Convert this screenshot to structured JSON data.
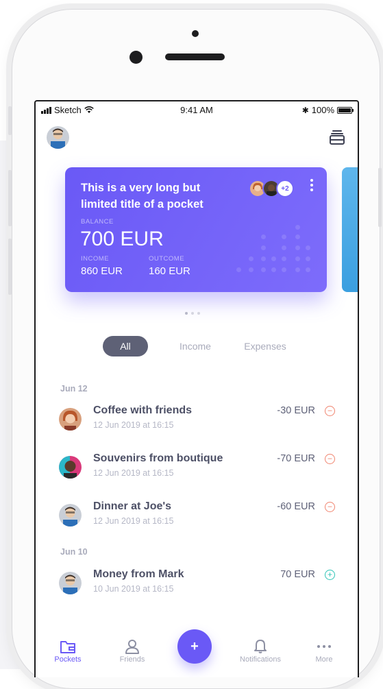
{
  "status_bar": {
    "carrier": "Sketch",
    "time": "9:41 AM",
    "battery": "100%"
  },
  "card": {
    "title": "This is a very long but limited title of a pocket",
    "members_extra": "+2",
    "balance_label": "BALANCE",
    "balance": "700 EUR",
    "income_label": "INCOME",
    "income": "860 EUR",
    "outcome_label": "OUTCOME",
    "outcome": "160 EUR"
  },
  "filter_tabs": [
    {
      "label": "All"
    },
    {
      "label": "Income"
    },
    {
      "label": "Expenses"
    }
  ],
  "groups": [
    {
      "date": "Jun 12"
    },
    {
      "date": "Jun 10"
    }
  ],
  "transactions": [
    {
      "title": "Coffee with friends",
      "subtitle": "12 Jun 2019 at 16:15",
      "amount": "-30 EUR",
      "sign": "−",
      "color": "#f0846f"
    },
    {
      "title": "Souvenirs from boutique",
      "subtitle": "12 Jun 2019 at 16:15",
      "amount": "-70 EUR",
      "sign": "−",
      "color": "#f0846f"
    },
    {
      "title": "Dinner at Joe's",
      "subtitle": "12 Jun 2019 at 16:15",
      "amount": "-60 EUR",
      "sign": "−",
      "color": "#f0846f"
    },
    {
      "title": "Money from Mark",
      "subtitle": "10 Jun 2019 at 16:15",
      "amount": "70 EUR",
      "sign": "+",
      "color": "#2ec4b6"
    }
  ],
  "nav": {
    "pockets": "Pockets",
    "friends": "Friends",
    "fab": "+",
    "notifications": "Notifications",
    "more": "More"
  },
  "colors": {
    "accent": "#6a59f6",
    "negative": "#f0846f",
    "positive": "#2ec4b6"
  }
}
